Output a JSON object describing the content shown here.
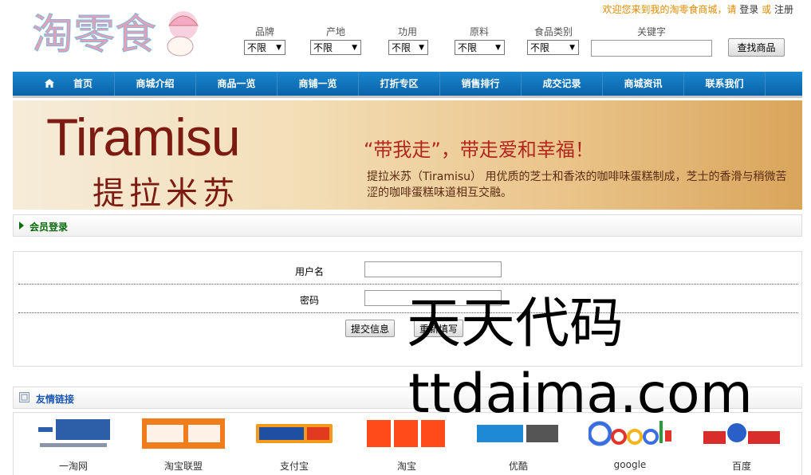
{
  "site": {
    "logo_text": "淘零食",
    "welcome": "欢迎您来到我的淘零食商城，请",
    "login_link": "登录",
    "or": "或",
    "register_link": "注册"
  },
  "filters": [
    {
      "label": "品牌",
      "value": "不限"
    },
    {
      "label": "产地",
      "value": "不限"
    },
    {
      "label": "功用",
      "value": "不限"
    },
    {
      "label": "原料",
      "value": "不限"
    },
    {
      "label": "食品类别",
      "value": "不限"
    }
  ],
  "keyword_label": "关键字",
  "search_button": "查找商品",
  "nav": [
    "首页",
    "商城介绍",
    "商品一览",
    "商铺一览",
    "打折专区",
    "销售排行",
    "成交记录",
    "商城资讯",
    "联系我们"
  ],
  "banner": {
    "title_en": "Tiramisu",
    "title_cn": "提拉米苏",
    "slogan": "“带我走”，带走爱和幸福！",
    "desc": "提拉米苏（Tiramisu）  用优质的芝士和香浓的咖啡味蛋糕制成，芝士的香滑与稍微苦涩的咖啡蛋糕味道相互交融。"
  },
  "member_login": {
    "title": "会员登录",
    "username_label": "用户名",
    "password_label": "密码",
    "submit": "提交信息",
    "reset": "重新填写"
  },
  "links": {
    "title": "友情链接",
    "items": [
      "一淘网",
      "淘宝联盟",
      "支付宝",
      "淘宝",
      "优酷",
      "google",
      "百度"
    ]
  },
  "watermark": {
    "line1": "天天代码",
    "line2": "ttdaima.com"
  },
  "colors": {
    "nav_bg": "#0a62a8",
    "accent_orange": "#e08a00",
    "panel_title_green": "#0b6b0b"
  }
}
